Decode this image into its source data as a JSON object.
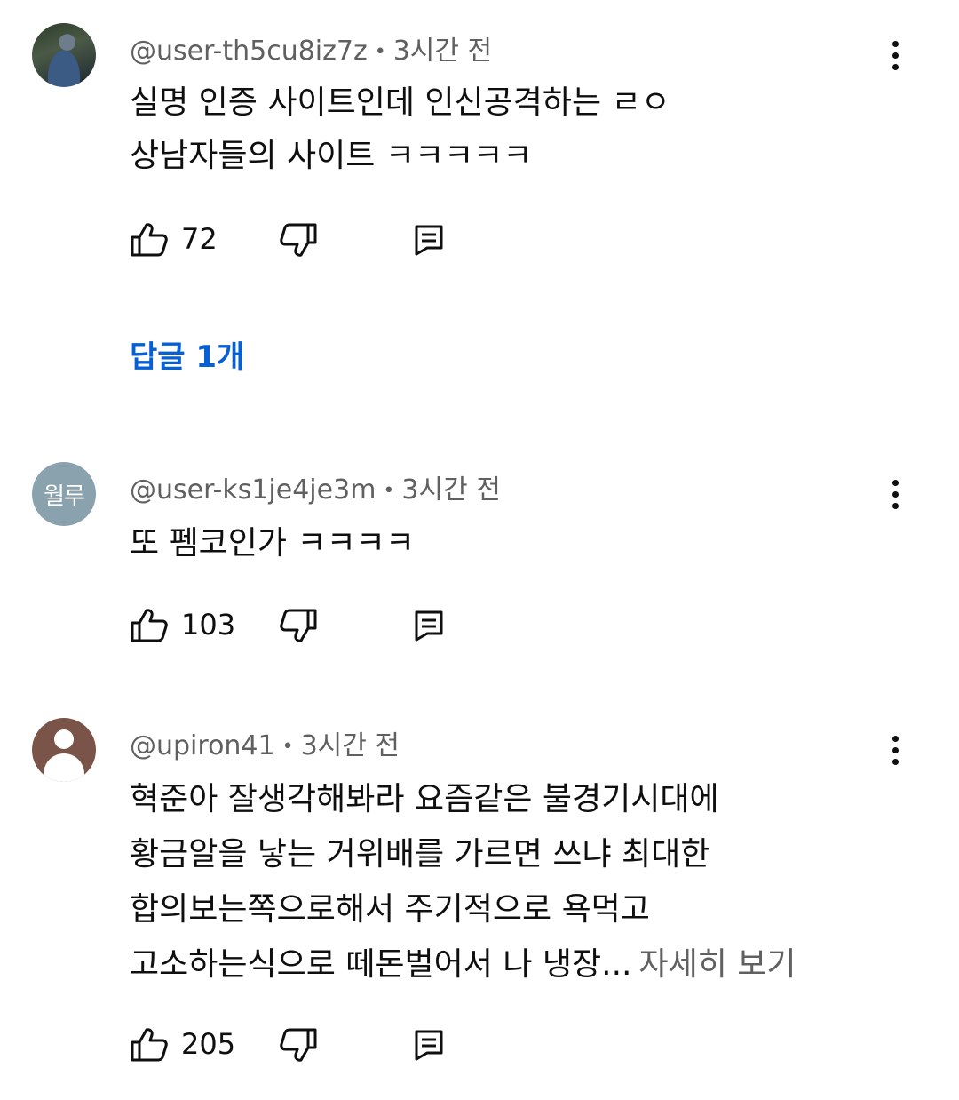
{
  "comments": [
    {
      "author": "@user-th5cu8iz7z",
      "time": "3시간 전",
      "lines": [
        "실명 인증 사이트인데 인신공격하는 ㄹㅇ",
        "상남자들의 사이트 ㅋㅋㅋㅋㅋ"
      ],
      "likes": "72"
    },
    {
      "author": "@user-ks1je4je3m",
      "avatar_text": "월루",
      "time": "3시간 전",
      "lines": [
        "또 펨코인가 ㅋㅋㅋㅋ"
      ],
      "likes": "103"
    },
    {
      "author": "@upiron41",
      "time": "3시간 전",
      "lines": [
        "혁준아 잘생각해봐라 요즘같은 불경기시대에",
        "황금알을 낳는 거위배를 가르면 쓰냐 최대한",
        "합의보는쪽으로해서 주기적으로 욕먹고",
        "고소하는식으로 떼돈벌어서 나 냉장..."
      ],
      "read_more": "자세히 보기",
      "likes": "205"
    }
  ],
  "replies_label": "답글 1개",
  "colors": {
    "text": "#0f0f0f",
    "secondary": "#606060",
    "link": "#065fd4",
    "background": "#ffffff"
  },
  "icons": [
    "thumb-up-icon",
    "thumb-down-icon",
    "reply-icon",
    "more-vert-icon"
  ]
}
